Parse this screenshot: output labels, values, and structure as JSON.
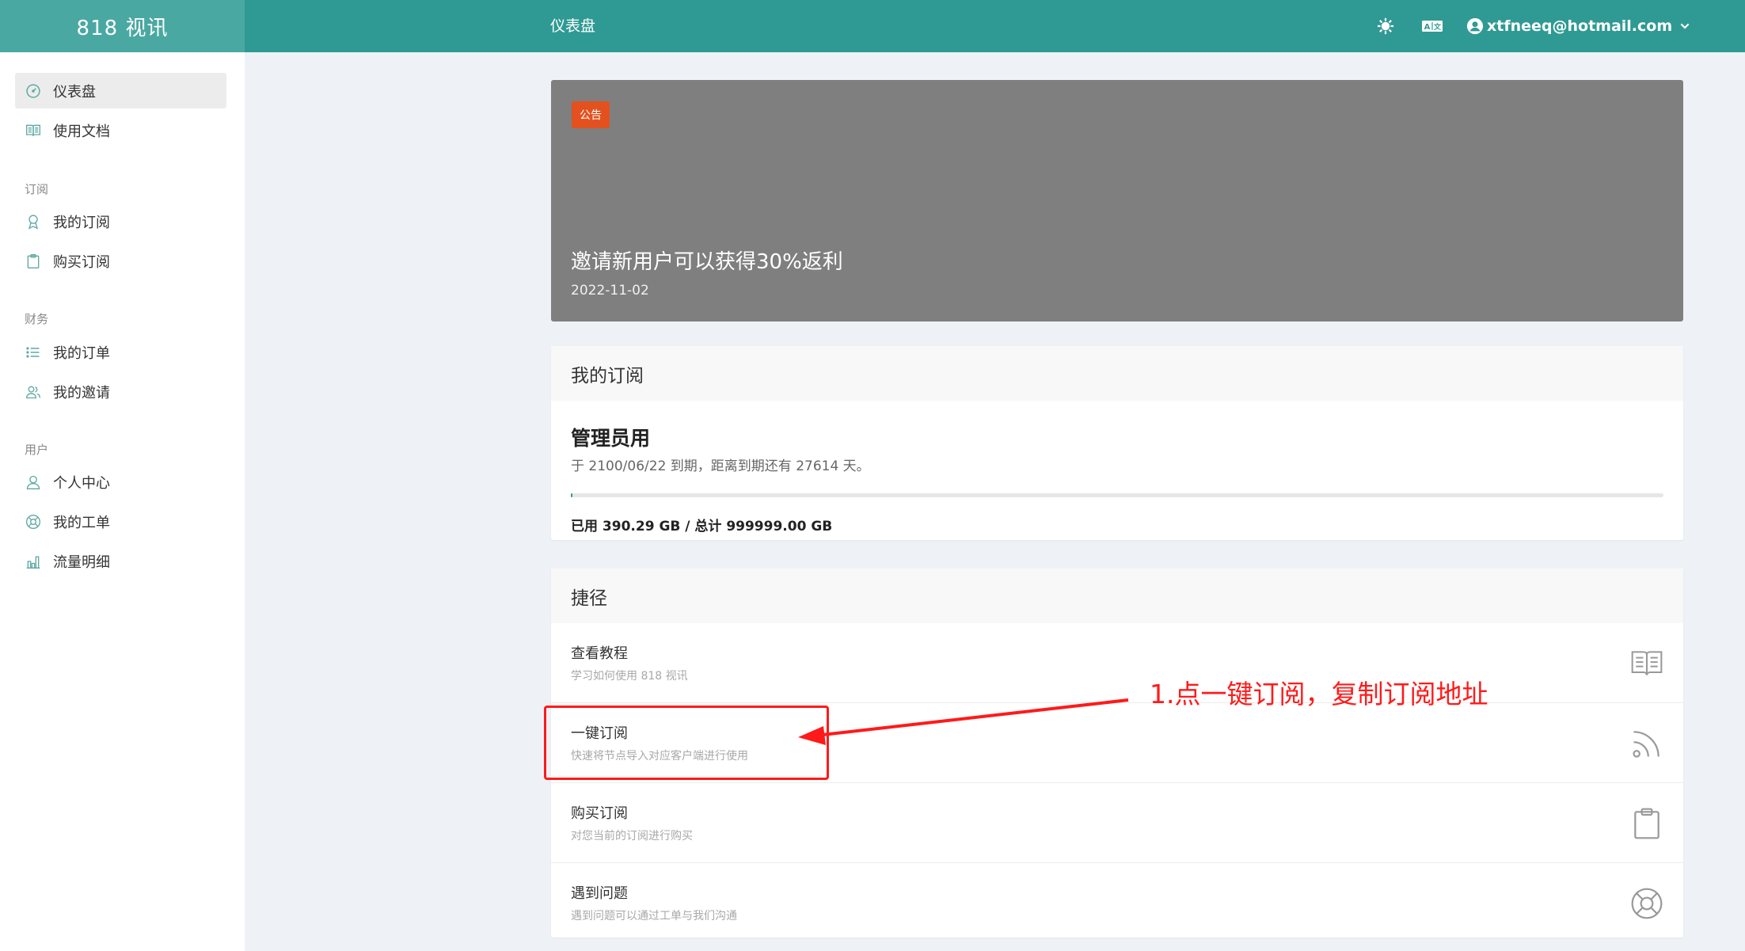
{
  "header": {
    "brand": "818 视讯",
    "page_title": "仪表盘",
    "user_email": "xtfneeq@hotmail.com"
  },
  "sidebar": {
    "items_top": [
      {
        "label": "仪表盘",
        "icon": "dashboard-icon",
        "active": true
      },
      {
        "label": "使用文档",
        "icon": "book-icon"
      }
    ],
    "groups": [
      {
        "title": "订阅",
        "items": [
          {
            "label": "我的订阅",
            "icon": "award-icon"
          },
          {
            "label": "购买订阅",
            "icon": "clipboard-icon"
          }
        ]
      },
      {
        "title": "财务",
        "items": [
          {
            "label": "我的订单",
            "icon": "list-icon"
          },
          {
            "label": "我的邀请",
            "icon": "users-icon"
          }
        ]
      },
      {
        "title": "用户",
        "items": [
          {
            "label": "个人中心",
            "icon": "user-icon"
          },
          {
            "label": "我的工单",
            "icon": "lifebuoy-icon"
          },
          {
            "label": "流量明细",
            "icon": "bar-chart-icon"
          }
        ]
      }
    ]
  },
  "notice": {
    "badge": "公告",
    "title": "邀请新用户可以获得30%返利",
    "date": "2022-11-02"
  },
  "subscription": {
    "heading": "我的订阅",
    "plan": "管理员用",
    "expiry": "于 2100/06/22 到期，距离到期还有 27614 天。",
    "usage_fraction": 0.0004,
    "usage": "已用 390.29 GB / 总计 999999.00 GB"
  },
  "shortcuts": {
    "heading": "捷径",
    "items": [
      {
        "title": "查看教程",
        "desc": "学习如何使用 818 视讯",
        "icon": "book-icon"
      },
      {
        "title": "一键订阅",
        "desc": "快速将节点导入对应客户端进行使用",
        "icon": "rss-icon"
      },
      {
        "title": "购买订阅",
        "desc": "对您当前的订阅进行购买",
        "icon": "clipboard-icon"
      },
      {
        "title": "遇到问题",
        "desc": "遇到问题可以通过工单与我们沟通",
        "icon": "lifebuoy-icon"
      }
    ]
  },
  "annotation": {
    "text": "1.点一键订阅，复制订阅地址",
    "color": "#ff1a1a"
  },
  "colors": {
    "primary": "#2f9a93",
    "brand_bg": "#4aa8a2",
    "badge": "#e3511f",
    "notice_bg": "#7f7f7f"
  }
}
